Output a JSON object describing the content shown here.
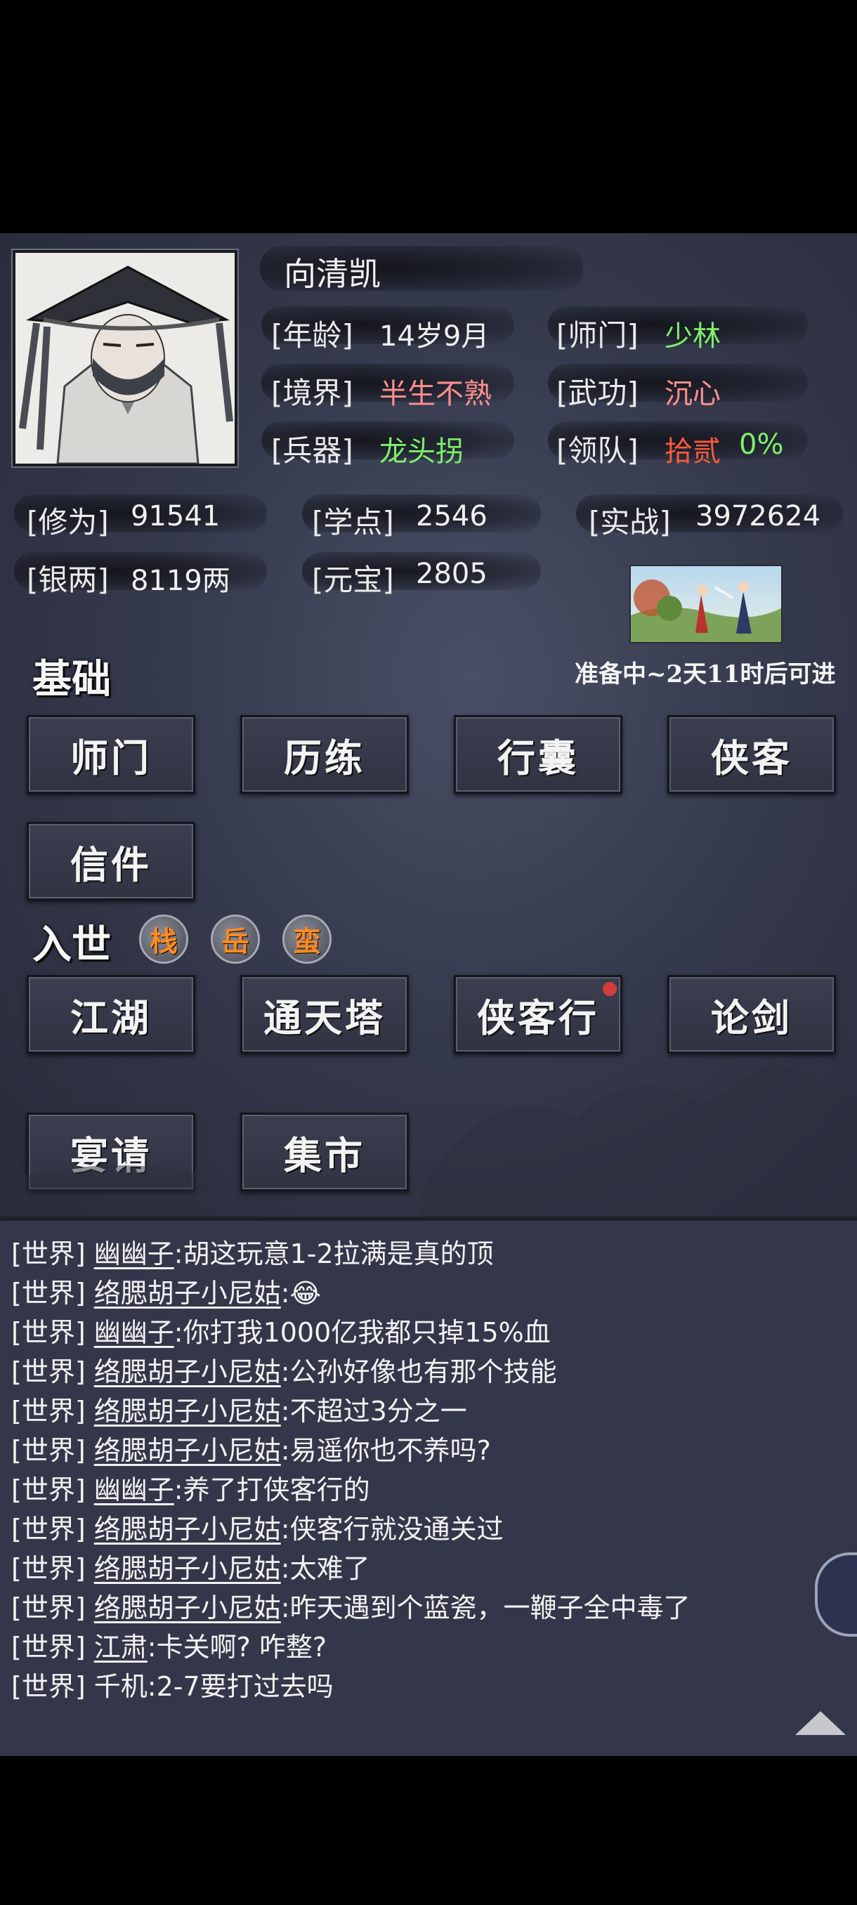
{
  "player": {
    "name": "向清凯",
    "age_label": "[年龄]",
    "age_value": "14岁9月",
    "sect_label": "[师门]",
    "sect_value": "少林",
    "realm_label": "[境界]",
    "realm_value": "半生不熟",
    "martial_label": "[武功]",
    "martial_value": "沉心",
    "weapon_label": "[兵器]",
    "weapon_value": "龙头拐",
    "team_label": "[领队]",
    "team_value": "拾贰",
    "team_percent": "0%"
  },
  "stats": {
    "cultivation_label": "[修为]",
    "cultivation_value": "91541",
    "study_label": "[学点]",
    "study_value": "2546",
    "combat_label": "[实战]",
    "combat_value": "3972624",
    "silver_label": "[银两]",
    "silver_value": "8119两",
    "ingot_label": "[元宝]",
    "ingot_value": "2805"
  },
  "event": {
    "countdown": "准备中~2天11时后可进"
  },
  "sections": {
    "basic": {
      "title": "基础",
      "buttons": [
        "师门",
        "历练",
        "行囊",
        "侠客",
        "信件"
      ]
    },
    "world": {
      "title": "入世",
      "coins": [
        "栈",
        "岳",
        "蛮"
      ],
      "buttons": [
        "江湖",
        "通天塔",
        "侠客行",
        "论剑",
        "宴请",
        "集市"
      ]
    }
  },
  "chat": {
    "channel": "[世界]",
    "messages": [
      {
        "user": "幽幽子",
        "text": ":胡这玩意1-2拉满是真的顶"
      },
      {
        "user": "络腮胡子小尼姑",
        "text": ":😂"
      },
      {
        "user": "幽幽子",
        "text": ":你打我1000亿我都只掉15%血"
      },
      {
        "user": "络腮胡子小尼姑",
        "text": ":公孙好像也有那个技能"
      },
      {
        "user": "络腮胡子小尼姑",
        "text": ":不超过3分之一"
      },
      {
        "user": "络腮胡子小尼姑",
        "text": ":易遥你也不养吗?"
      },
      {
        "user": "幽幽子",
        "text": ":养了打侠客行的"
      },
      {
        "user": "络腮胡子小尼姑",
        "text": ":侠客行就没通关过"
      },
      {
        "user": "络腮胡子小尼姑",
        "text": ":太难了"
      },
      {
        "user": "络腮胡子小尼姑",
        "text": ":昨天遇到个蓝瓷，一鞭子全中毒了"
      },
      {
        "user": "江肃",
        "text": ":卡关啊? 咋整?"
      },
      {
        "user": "千机",
        "text": ":2-7要打过去吗"
      }
    ]
  },
  "colors": {
    "green": "#7df06a",
    "pink": "#ff8f8f",
    "red": "#ff5a3a",
    "coin_text": "#ff8a1e"
  }
}
